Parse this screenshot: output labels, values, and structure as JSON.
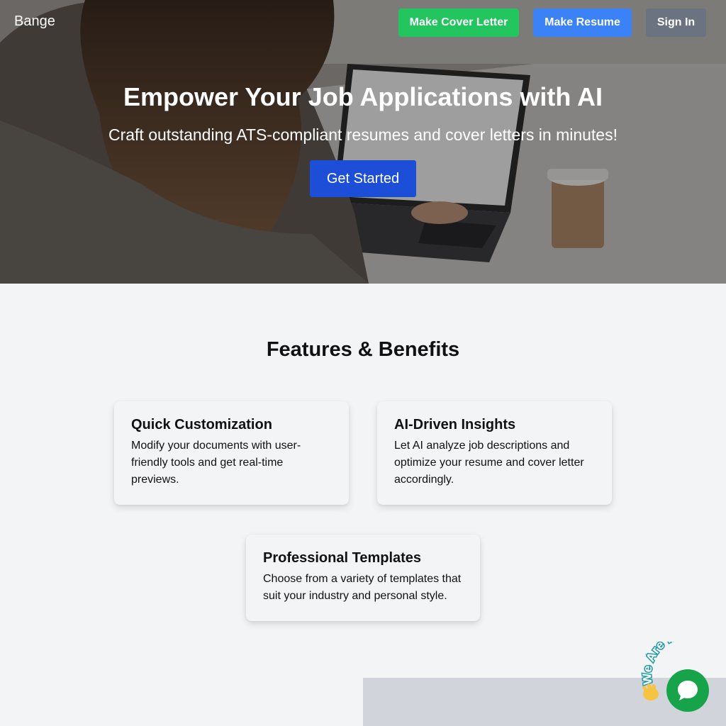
{
  "nav": {
    "brand": "Bange",
    "cover_letter_label": "Make Cover Letter",
    "resume_label": "Make Resume",
    "signin_label": "Sign In"
  },
  "hero": {
    "title": "Empower Your Job Applications with AI",
    "subtitle": "Craft outstanding ATS-compliant resumes and cover letters in minutes!",
    "cta_label": "Get Started"
  },
  "features": {
    "title": "Features & Benefits",
    "items": [
      {
        "title": "Quick Customization",
        "text": "Modify your documents with user-friendly tools and get real-time previews."
      },
      {
        "title": "AI-Driven Insights",
        "text": "Let AI analyze job descriptions and optimize your resume and cover letter accordingly."
      },
      {
        "title": "Professional Templates",
        "text": "Choose from a variety of templates that suit your industry and personal style."
      }
    ]
  },
  "chat": {
    "badge_text": "We Are Here!",
    "icons": [
      "chat-bubble-icon",
      "waving-hand-icon"
    ]
  },
  "colors": {
    "cover_letter": "#22c55e",
    "resume": "#3b82f6",
    "signin": "#6b7280",
    "cta": "#1d4ed8",
    "chat": "#16a34a"
  }
}
